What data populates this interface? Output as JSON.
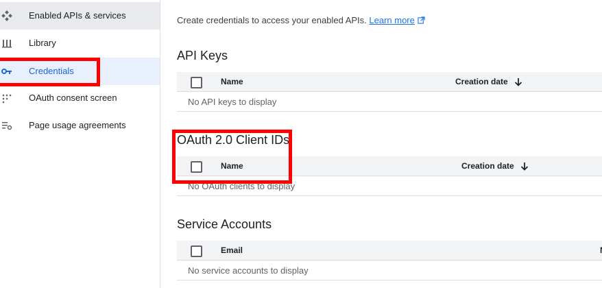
{
  "sidebar": {
    "items": [
      {
        "label": "Enabled APIs & services",
        "icon": "apis-diamond-icon"
      },
      {
        "label": "Library",
        "icon": "library-icon"
      },
      {
        "label": "Credentials",
        "icon": "key-icon"
      },
      {
        "label": "OAuth consent screen",
        "icon": "oauth-consent-icon"
      },
      {
        "label": "Page usage agreements",
        "icon": "settings-list-icon"
      }
    ]
  },
  "main": {
    "intro_text": "Create credentials to access your enabled APIs.",
    "learn_more": "Learn more",
    "api_keys": {
      "title": "API Keys",
      "columns": [
        "Name",
        "Creation date"
      ],
      "empty": "No API keys to display"
    },
    "oauth": {
      "title": "OAuth 2.0 Client IDs",
      "columns": [
        "Name",
        "Creation date"
      ],
      "empty": "No OAuth clients to display"
    },
    "service_accounts": {
      "title": "Service Accounts",
      "columns": [
        "Email",
        "N"
      ],
      "empty": "No service accounts to display"
    }
  },
  "colors": {
    "accent": "#1a73e8",
    "highlight": "#ff0000"
  }
}
